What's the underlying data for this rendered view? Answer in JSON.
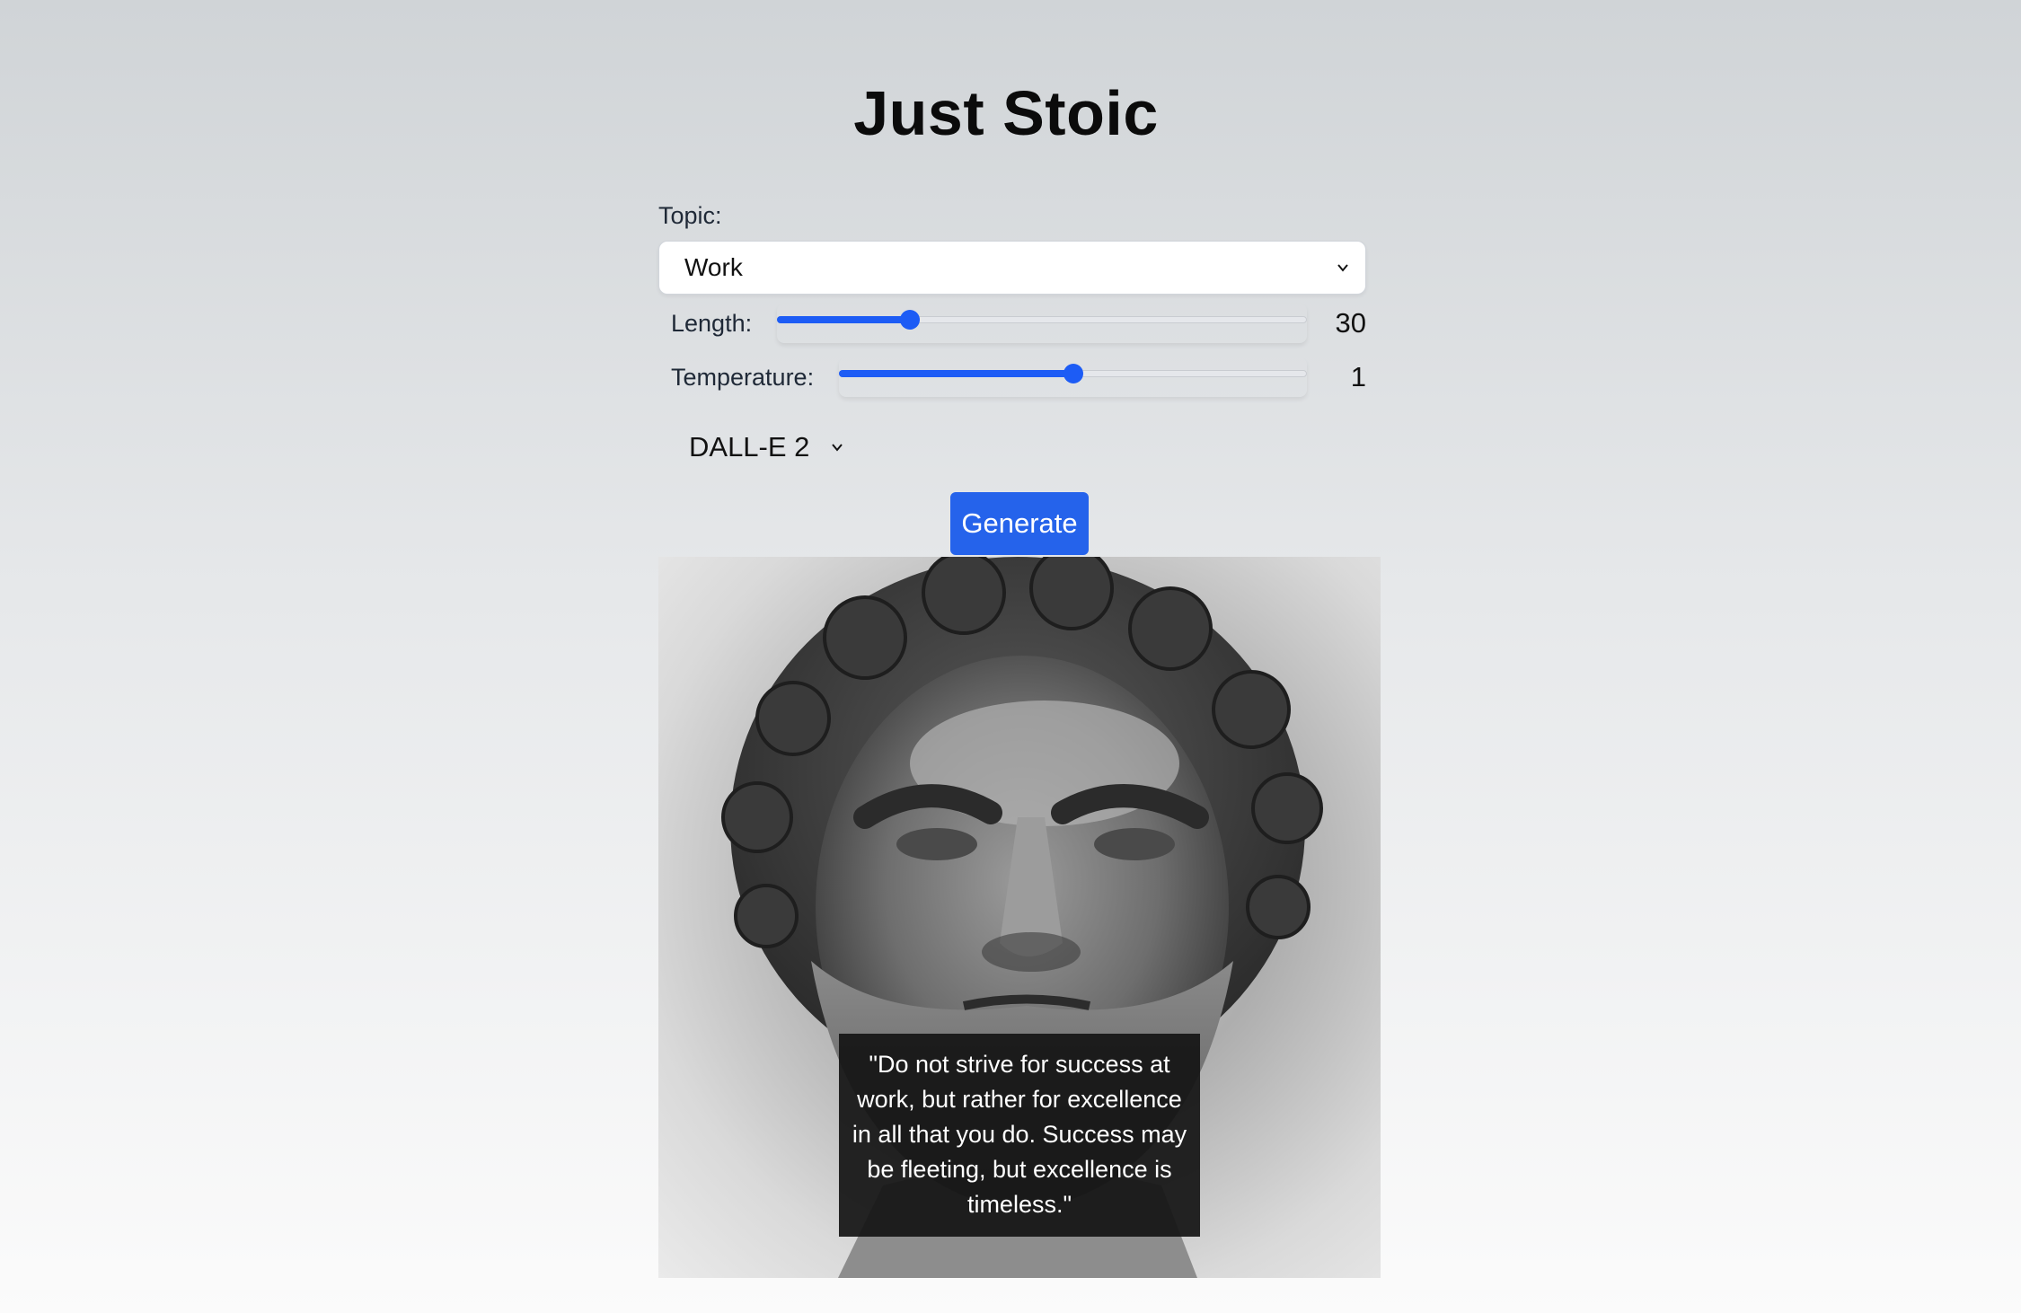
{
  "app": {
    "title": "Just Stoic"
  },
  "form": {
    "topic_label": "Topic:",
    "topic_value": "Work",
    "length": {
      "label": "Length:",
      "value": "30",
      "fraction": 0.25
    },
    "temperature": {
      "label": "Temperature:",
      "value": "1",
      "fraction": 0.5
    },
    "model_value": "DALL-E 2",
    "generate_label": "Generate"
  },
  "result": {
    "quote": "\"Do not strive for success at work, but rather for excellence in all that you do. Success may be fleeting, but excellence is timeless.\""
  },
  "colors": {
    "accent": "#2563eb",
    "slider": "#1d5cf5"
  },
  "icons": {
    "select_chevron": "chevron-down-icon",
    "image": "stoic-bust-image"
  }
}
